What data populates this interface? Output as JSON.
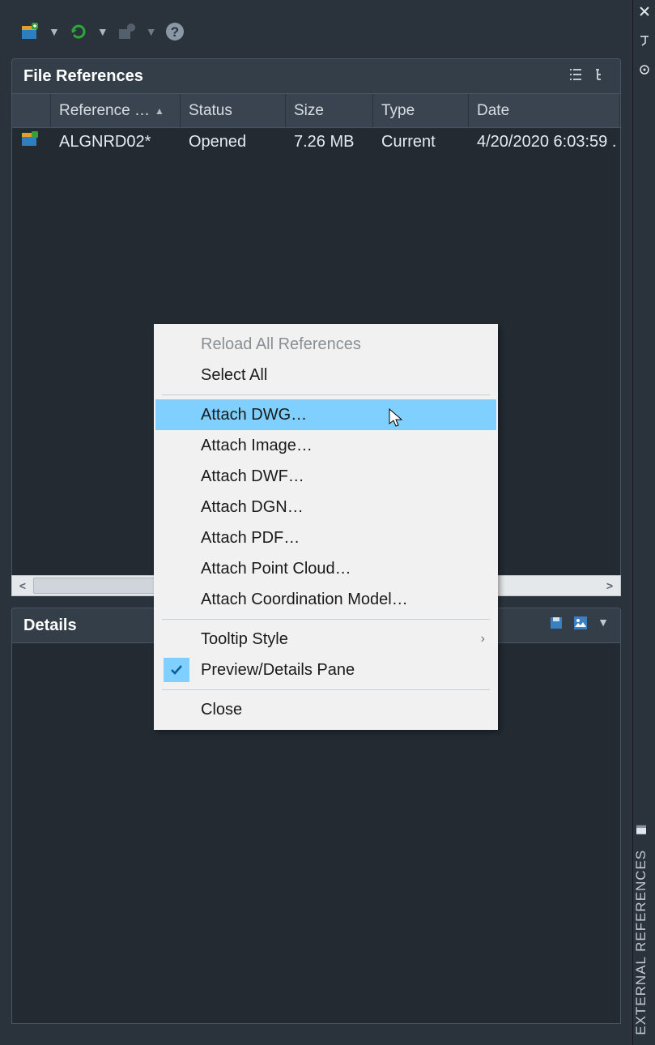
{
  "panel_title": "File References",
  "details_title": "Details",
  "vertical_title": "EXTERNAL REFERENCES",
  "columns": [
    "Reference …",
    "Status",
    "Size",
    "Type",
    "Date"
  ],
  "rows": [
    {
      "name": "ALGNRD02*",
      "status": "Opened",
      "size": "7.26 MB",
      "type": "Current",
      "date": "4/20/2020 6:03:59 ."
    }
  ],
  "context_menu": {
    "reload_all": "Reload All References",
    "select_all": "Select All",
    "attach_dwg": "Attach DWG…",
    "attach_image": "Attach Image…",
    "attach_dwf": "Attach DWF…",
    "attach_dgn": "Attach DGN…",
    "attach_pdf": "Attach PDF…",
    "attach_pointcloud": "Attach Point Cloud…",
    "attach_coord": "Attach Coordination Model…",
    "tooltip_style": "Tooltip Style",
    "preview_pane": "Preview/Details Pane",
    "close": "Close"
  }
}
